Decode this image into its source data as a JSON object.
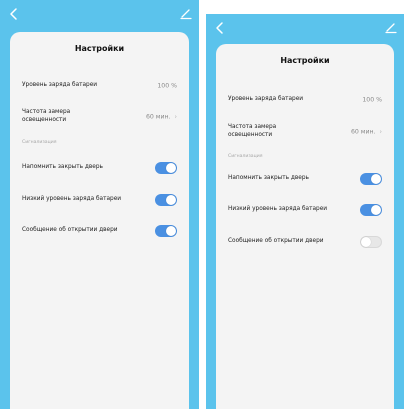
{
  "colors": {
    "header_bg": "#5bc3ec",
    "card_bg": "#f4f4f4",
    "toggle_on": "#4a90e2",
    "toggle_off": "#e7e7e7"
  },
  "screens": [
    {
      "title": "Настройки",
      "battery": {
        "label": "Уровень заряда батареи",
        "value": "100 %"
      },
      "frequency": {
        "label_line1": "Частота замера",
        "label_line2": "освещенности",
        "value": "60 мин."
      },
      "section_label": "Сигнализация",
      "toggles": [
        {
          "label": "Напомнить закрыть дверь",
          "state": "on"
        },
        {
          "label": "Низкий уровень заряда батареи",
          "state": "on"
        },
        {
          "label": "Сообщение об открытии двери",
          "state": "on"
        }
      ]
    },
    {
      "title": "Настройки",
      "battery": {
        "label": "Уровень заряда батареи",
        "value": "100 %"
      },
      "frequency": {
        "label_line1": "Частота замера",
        "label_line2": "освещенности",
        "value": "60 мин."
      },
      "section_label": "Сигнализация",
      "toggles": [
        {
          "label": "Напомнить закрыть дверь",
          "state": "on"
        },
        {
          "label": "Низкий уровень заряда батареи",
          "state": "on"
        },
        {
          "label": "Сообщение об открытии двери",
          "state": "off"
        }
      ]
    }
  ],
  "icons": {
    "back": "chevron-left-icon",
    "edit": "pencil-icon"
  }
}
